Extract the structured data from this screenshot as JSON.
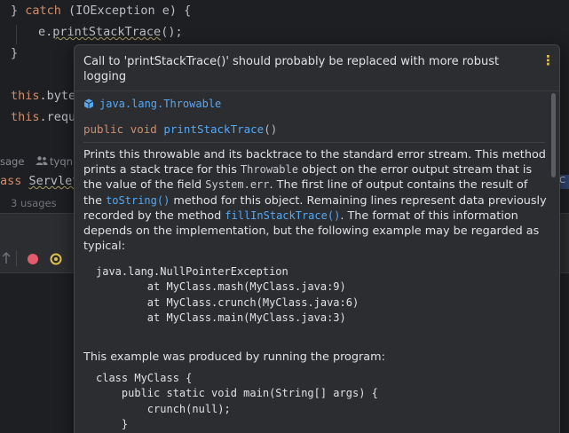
{
  "editor": {
    "line1_brace": "}",
    "line1_catch": "catch",
    "line1_rest": " (IOException e) {",
    "line2_obj": "e.",
    "line2_call": "printStackTrace",
    "line2_end": "();",
    "line3": "}",
    "line4_this": "this",
    "line4_rest": ".byte",
    "line5_this": "this",
    "line5_rest": ".requ",
    "hint_usage": "sage",
    "hint_author": "tyqn",
    "servlet_kw": "ass",
    "servlet_name": "Servlet",
    "usages": "3 usages",
    "right_badge": "C"
  },
  "popup": {
    "title": "Call to 'printStackTrace()' should probably be replaced with more robust logging",
    "menu_icon": "kebab-menu-icon",
    "class_ref": "java.lang.Throwable",
    "signature": {
      "modifier": "public",
      "type": "void",
      "method": "printStackTrace",
      "parens": "()"
    },
    "description": {
      "t1": "Prints this throwable and its backtrace to the standard error stream. This method prints a stack trace for this ",
      "c1": "Throwable",
      "t2": " object on the error output stream that is the value of the field ",
      "c2": "System.err",
      "t3": ". The first line of output contains the result of the ",
      "l1": "toString()",
      "t4": " method for this object. Remaining lines represent data previously recorded by the method ",
      "l2": "fillInStackTrace()",
      "t5": ". The format of this information depends on the implementation, but the following example may be regarded as typical:"
    },
    "example_trace": [
      "java.lang.NullPointerException",
      "        at MyClass.mash(MyClass.java:9)",
      "        at MyClass.crunch(MyClass.java:6)",
      "        at MyClass.main(MyClass.java:3)"
    ],
    "paragraph2": "This example was produced by running the program:",
    "example_program": [
      "class MyClass {",
      "    public static void main(String[] args) {",
      "        crunch(null);",
      "    }"
    ]
  },
  "colors": {
    "keyword": "#cf8e6d",
    "link": "#56a8f5",
    "popup_bg": "#2b2d30",
    "editor_bg": "#1e1f22"
  }
}
